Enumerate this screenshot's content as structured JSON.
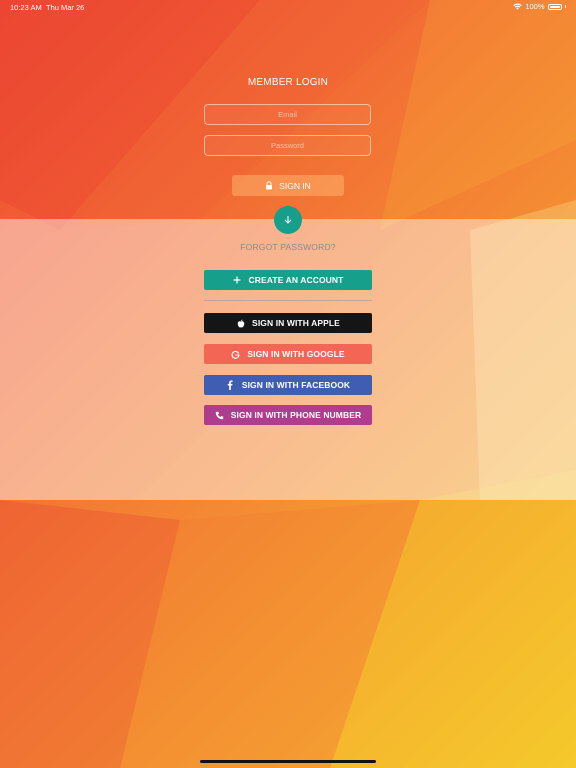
{
  "status_bar": {
    "time": "10:23 AM",
    "date": "Thu Mar 26",
    "battery": "100%",
    "icons": [
      "wifi-icon",
      "battery-icon"
    ]
  },
  "login": {
    "title": "MEMBER LOGIN",
    "email_placeholder": "Email",
    "password_placeholder": "Password",
    "signin_label": "SIGN IN",
    "signin_icon": "lock-icon"
  },
  "panel": {
    "toggle_icon": "arrow-down-icon",
    "forgot_label": "FORGOT PASSWORD?",
    "buttons": [
      {
        "label": "CREATE AN ACCOUNT",
        "icon": "plus-icon",
        "color": "#16a08b"
      },
      {
        "label": "SIGN IN WITH APPLE",
        "icon": "apple-icon",
        "color": "#151515"
      },
      {
        "label": "SIGN IN WITH GOOGLE",
        "icon": "google-icon",
        "color": "#f36656"
      },
      {
        "label": "SIGN IN WITH FACEBOOK",
        "icon": "facebook-icon",
        "color": "#3f5db2"
      },
      {
        "label": "SIGN IN WITH PHONE NUMBER",
        "icon": "phone-icon",
        "color": "#b03c8e"
      }
    ]
  },
  "colors": {
    "background_start": "#ee4a35",
    "background_end": "#f5c62c",
    "accent": "#16a08b"
  }
}
